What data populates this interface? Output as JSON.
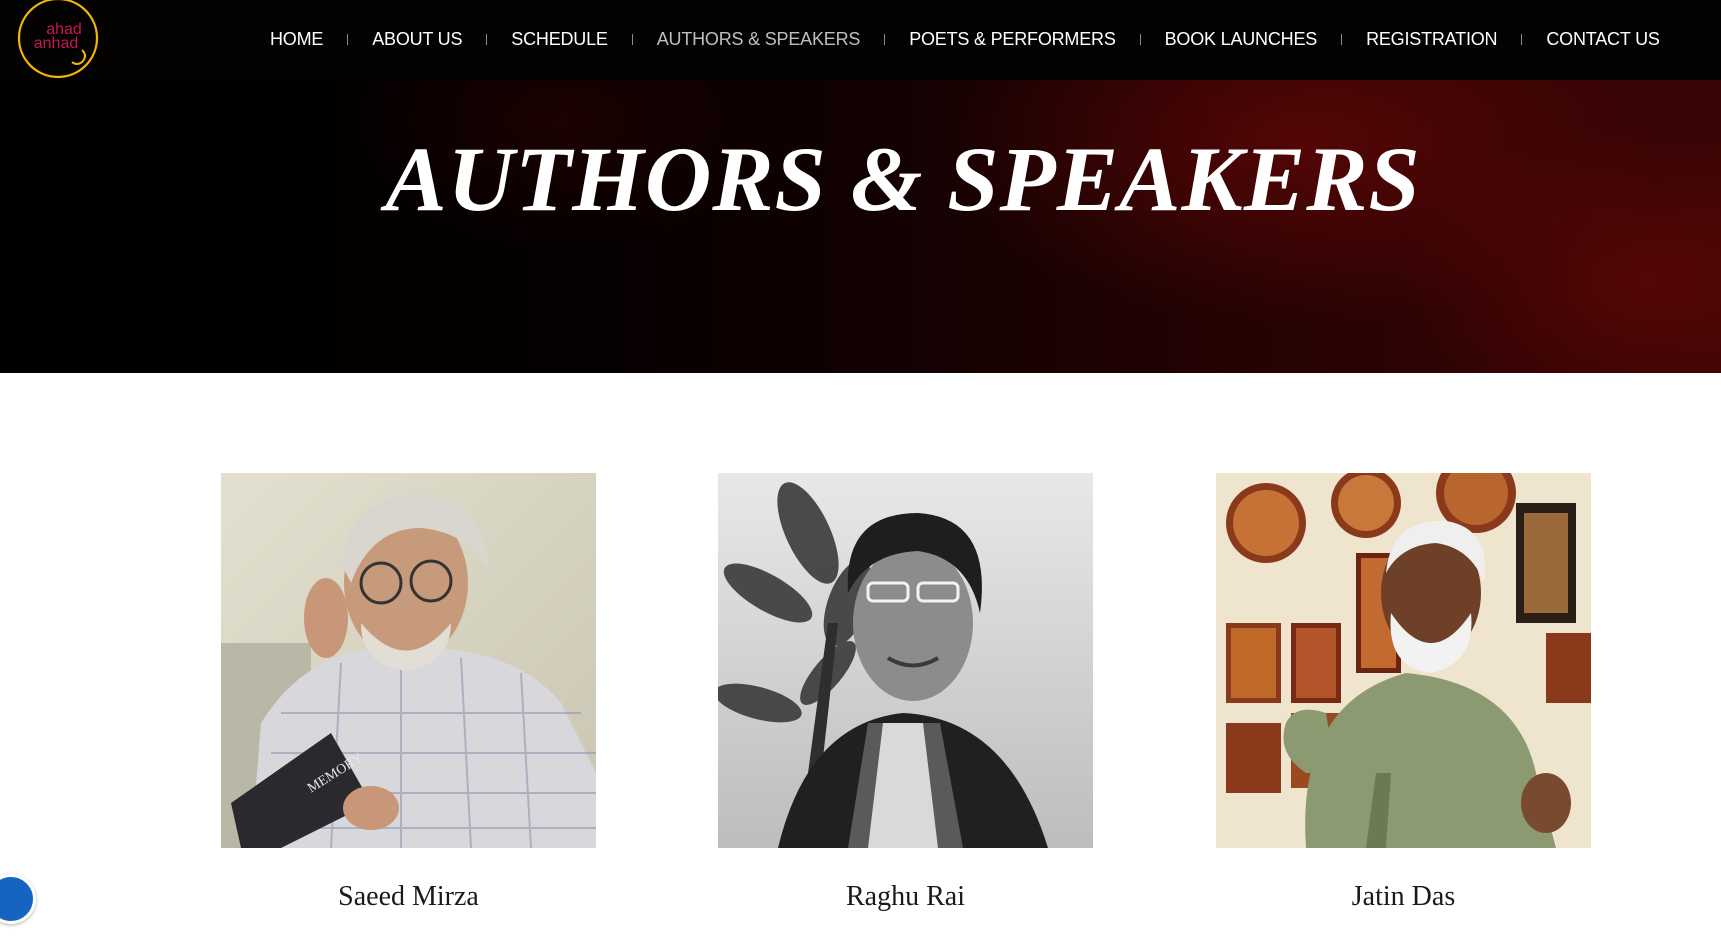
{
  "logo": {
    "line1": "ahad",
    "line2": "anhad",
    "accent": "#f2b705",
    "text_color": "#c2185b"
  },
  "nav": {
    "items": [
      {
        "label": "HOME",
        "active": false
      },
      {
        "label": "ABOUT US",
        "active": false
      },
      {
        "label": "SCHEDULE",
        "active": false
      },
      {
        "label": "AUTHORS & SPEAKERS",
        "active": true
      },
      {
        "label": "POETS & PERFORMERS",
        "active": false
      },
      {
        "label": "BOOK LAUNCHES",
        "active": false
      },
      {
        "label": "REGISTRATION",
        "active": false
      },
      {
        "label": "CONTACT US",
        "active": false
      }
    ]
  },
  "hero": {
    "title": "AUTHORS & SPEAKERS"
  },
  "speakers": [
    {
      "name": "Saeed Mirza",
      "photo": "portrait-photo-reading-book"
    },
    {
      "name": "Raghu Rai",
      "photo": "portrait-photo-black-and-white"
    },
    {
      "name": "Jatin Das",
      "photo": "portrait-photo-gallery"
    }
  ],
  "widget": {
    "icon": "chat-widget-icon",
    "color": "#1565c0"
  }
}
